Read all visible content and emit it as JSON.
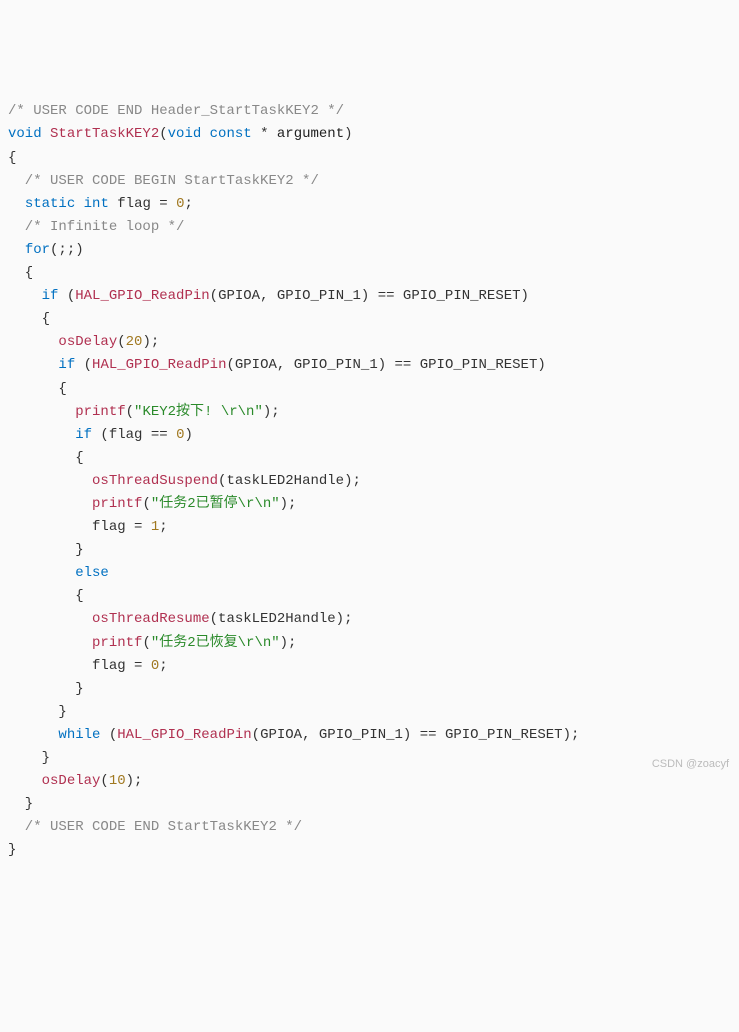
{
  "code": {
    "l1_comment": "/* USER CODE END Header_StartTaskKEY2 */",
    "l2_void": "void",
    "l2_fn": "StartTaskKEY2",
    "l2_p_open": "(",
    "l2_void2": "void",
    "l2_const": "const",
    "l2_star": " * ",
    "l2_arg": "argument",
    "l2_p_close": ")",
    "l3_brace": "{",
    "l4_comment": "  /* USER CODE BEGIN StartTaskKEY2 */",
    "l5_indent": "  ",
    "l5_static": "static",
    "l5_sp": " ",
    "l5_int": "int",
    "l5_sp2": " ",
    "l5_flag": "flag",
    "l5_eq": " = ",
    "l5_zero": "0",
    "l5_semi": ";",
    "l6_comment": "  /* Infinite loop */",
    "l7_indent": "  ",
    "l7_for": "for",
    "l7_rest": "(;;)",
    "l8_brace": "  {",
    "l9_indent": "    ",
    "l9_if": "if",
    "l9_sp": " (",
    "l9_fn": "HAL_GPIO_ReadPin",
    "l9_open": "(",
    "l9_a1": "GPIOA",
    "l9_c": ", ",
    "l9_a2": "GPIO_PIN_1",
    "l9_close": ")",
    "l9_eq": " == ",
    "l9_reset": "GPIO_PIN_RESET",
    "l9_end": ")",
    "l10_brace": "    {",
    "l11_indent": "      ",
    "l11_fn": "osDelay",
    "l11_open": "(",
    "l11_n": "20",
    "l11_close": ");",
    "l12_indent": "      ",
    "l12_if": "if",
    "l12_sp": " (",
    "l12_fn": "HAL_GPIO_ReadPin",
    "l12_open": "(",
    "l12_a1": "GPIOA",
    "l12_c": ", ",
    "l12_a2": "GPIO_PIN_1",
    "l12_close": ")",
    "l12_eq": " == ",
    "l12_reset": "GPIO_PIN_RESET",
    "l12_end": ")",
    "l13_brace": "      {",
    "l14_indent": "        ",
    "l14_fn": "printf",
    "l14_open": "(",
    "l14_str": "\"KEY2按下! \\r\\n\"",
    "l14_close": ");",
    "l15_indent": "        ",
    "l15_if": "if",
    "l15_sp": " (",
    "l15_flag": "flag",
    "l15_eq": " == ",
    "l15_zero": "0",
    "l15_end": ")",
    "l16_brace": "        {",
    "l17_indent": "          ",
    "l17_fn": "osThreadSuspend",
    "l17_open": "(",
    "l17_arg": "taskLED2Handle",
    "l17_close": ");",
    "l18_indent": "          ",
    "l18_fn": "printf",
    "l18_open": "(",
    "l18_str": "\"任务2已暂停\\r\\n\"",
    "l18_close": ");",
    "l19_indent": "          ",
    "l19_flag": "flag",
    "l19_eq": " = ",
    "l19_one": "1",
    "l19_semi": ";",
    "l20_brace": "        }",
    "l21_indent": "        ",
    "l21_else": "else",
    "l22_brace": "        {",
    "l23_indent": "          ",
    "l23_fn": "osThreadResume",
    "l23_open": "(",
    "l23_arg": "taskLED2Handle",
    "l23_close": ");",
    "l24_indent": "          ",
    "l24_fn": "printf",
    "l24_open": "(",
    "l24_str": "\"任务2已恢复\\r\\n\"",
    "l24_close": ");",
    "l25_indent": "          ",
    "l25_flag": "flag",
    "l25_eq": " = ",
    "l25_zero": "0",
    "l25_semi": ";",
    "l26_brace": "        }",
    "l27_brace": "      }",
    "l28_indent": "      ",
    "l28_while": "while",
    "l28_sp": " (",
    "l28_fn": "HAL_GPIO_ReadPin",
    "l28_open": "(",
    "l28_a1": "GPIOA",
    "l28_c": ", ",
    "l28_a2": "GPIO_PIN_1",
    "l28_close": ")",
    "l28_eq": " == ",
    "l28_reset": "GPIO_PIN_RESET",
    "l28_end": ");",
    "l29_brace": "    }",
    "l30_indent": "    ",
    "l30_fn": "osDelay",
    "l30_open": "(",
    "l30_n": "10",
    "l30_close": ");",
    "l31_brace": "  }",
    "l32_comment": "  /* USER CODE END StartTaskKEY2 */",
    "l33_brace": "}"
  },
  "watermark": "CSDN @zoacyf"
}
